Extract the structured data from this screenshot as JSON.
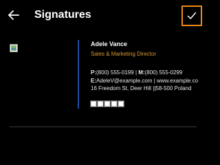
{
  "header": {
    "title": "Signatures",
    "back_icon": "arrow-left-icon",
    "confirm_icon": "checkmark-icon",
    "confirm_accent": "#ef8a1a"
  },
  "signature": {
    "name": "Adele Vance",
    "role": "Sales & Marketing Director",
    "phone_label": "P:",
    "phone": "(800) 555-0199",
    "separator": " | ",
    "mobile_label": "M:",
    "mobile": "(800) 555-0299",
    "email_label": "E:",
    "email": "AdeleV@example.com",
    "website": "www.example.co",
    "address": "16 Freedom St, Deer Hill ||58-500 Poland",
    "role_color": "#d99a2e",
    "divider_color": "#1d4fae",
    "social_icons": [
      "social-icon-1",
      "social-icon-2",
      "social-icon-3",
      "social-icon-4",
      "social-icon-5"
    ]
  }
}
